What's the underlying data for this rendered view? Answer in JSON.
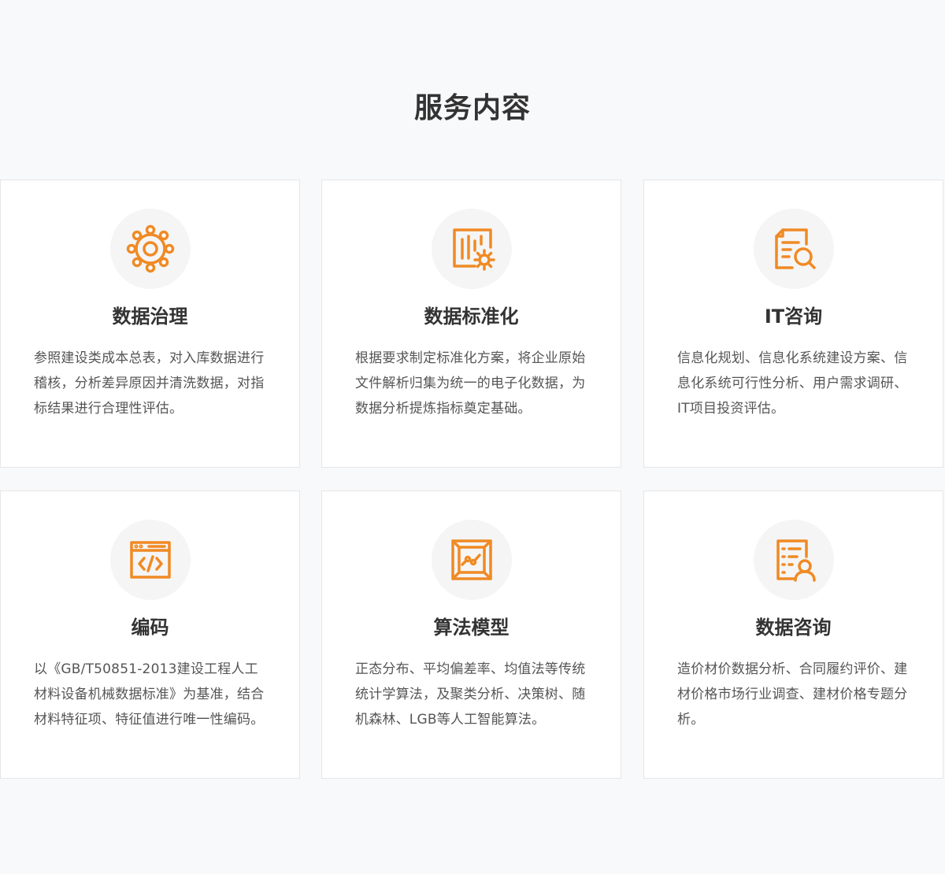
{
  "section": {
    "title": "服务内容"
  },
  "accent_color": "#f08a24",
  "cards": [
    {
      "icon": "gear-icon",
      "title": "数据治理",
      "desc": "参照建设类成本总表，对入库数据进行稽核，分析差异原因并清洗数据，对指标结果进行合理性评估。"
    },
    {
      "icon": "chart-gear-icon",
      "title": "数据标准化",
      "desc": "根据要求制定标准化方案，将企业原始文件解析归集为统一的电子化数据，为数据分析提炼指标奠定基础。"
    },
    {
      "icon": "document-search-icon",
      "title": "IT咨询",
      "desc": "信息化规划、信息化系统建设方案、信息化系统可行性分析、用户需求调研、IT项目投资评估。"
    },
    {
      "icon": "code-window-icon",
      "title": "编码",
      "desc": "以《GB/T50851-2013建设工程人工材料设备机械数据标准》为基准，结合材料特征项、特征值进行唯一性编码。"
    },
    {
      "icon": "model-box-icon",
      "title": "算法模型",
      "desc": "正态分布、平均偏差率、均值法等传统统计学算法，及聚类分析、决策树、随机森林、LGB等人工智能算法。"
    },
    {
      "icon": "document-user-icon",
      "title": "数据咨询",
      "desc": "造价材价数据分析、合同履约评价、建材价格市场行业调查、建材价格专题分析。"
    }
  ]
}
